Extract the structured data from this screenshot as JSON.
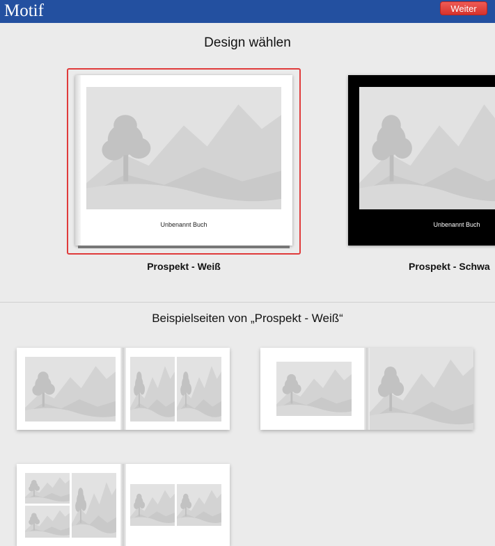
{
  "app": {
    "title": "Motif",
    "next_button": "Weiter"
  },
  "design_section": {
    "title": "Design wählen",
    "designs": [
      {
        "label": "Prospekt - Weiß",
        "cover_text": "Unbenannt Buch",
        "theme": "white",
        "selected": true
      },
      {
        "label": "Prospekt - Schwa",
        "cover_text": "Unbenannt Buch",
        "theme": "black",
        "selected": false
      }
    ]
  },
  "samples_section": {
    "title": "Beispielseiten von „Prospekt - Weiß“"
  },
  "colors": {
    "accent": "#e03a3a",
    "toolbar": "#2350a0",
    "placeholder": "#e0e0e0"
  },
  "icons": {
    "placeholder": "landscape-placeholder-icon"
  }
}
